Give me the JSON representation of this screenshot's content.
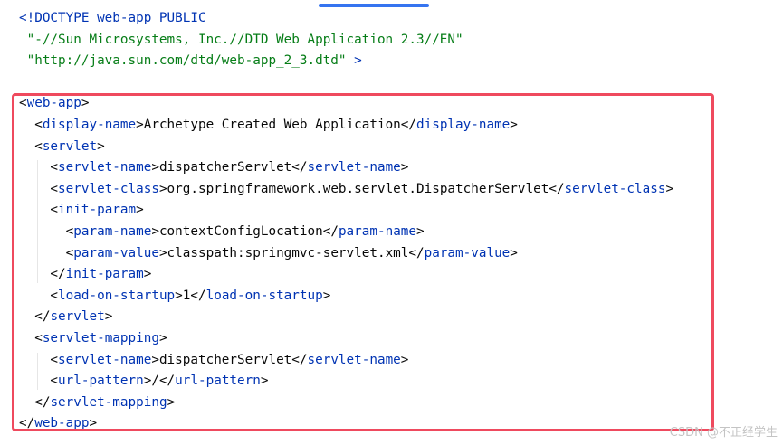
{
  "editor": {
    "colors": {
      "tag": "#0033b3",
      "text": "#080808",
      "string": "#067d17",
      "highlight": "#ef4a5e",
      "scroll_thumb": "#3574f0"
    },
    "lines": [
      [
        [
          "<!DOCTYPE web-app PUBLIC",
          "tag"
        ]
      ],
      [
        [
          " \"-//Sun Microsystems, Inc.//DTD Web Application 2.3//EN\"",
          "string"
        ]
      ],
      [
        [
          " \"http://java.sun.com/dtd/web-app_2_3.dtd\"",
          "string"
        ],
        [
          " >",
          "tag"
        ]
      ],
      [],
      [
        [
          "<",
          "text"
        ],
        [
          "web-app",
          "tag"
        ],
        [
          ">",
          "text"
        ]
      ],
      [
        [
          "  <",
          "text"
        ],
        [
          "display-name",
          "tag"
        ],
        [
          ">Archetype Created Web Application</",
          "text"
        ],
        [
          "display-name",
          "tag"
        ],
        [
          ">",
          "text"
        ]
      ],
      [
        [
          "  <",
          "text"
        ],
        [
          "servlet",
          "tag"
        ],
        [
          ">",
          "text"
        ]
      ],
      [
        [
          "    <",
          "text"
        ],
        [
          "servlet-name",
          "tag"
        ],
        [
          ">dispatcherServlet</",
          "text"
        ],
        [
          "servlet-name",
          "tag"
        ],
        [
          ">",
          "text"
        ]
      ],
      [
        [
          "    <",
          "text"
        ],
        [
          "servlet-class",
          "tag"
        ],
        [
          ">org.springframework.web.servlet.DispatcherServlet</",
          "text"
        ],
        [
          "servlet-class",
          "tag"
        ],
        [
          ">",
          "text"
        ]
      ],
      [
        [
          "    <",
          "text"
        ],
        [
          "init-param",
          "tag"
        ],
        [
          ">",
          "text"
        ]
      ],
      [
        [
          "      <",
          "text"
        ],
        [
          "param-name",
          "tag"
        ],
        [
          ">contextConfigLocation</",
          "text"
        ],
        [
          "param-name",
          "tag"
        ],
        [
          ">",
          "text"
        ]
      ],
      [
        [
          "      <",
          "text"
        ],
        [
          "param-value",
          "tag"
        ],
        [
          ">classpath:springmvc-servlet.xml</",
          "text"
        ],
        [
          "param-value",
          "tag"
        ],
        [
          ">",
          "text"
        ]
      ],
      [
        [
          "    </",
          "text"
        ],
        [
          "init-param",
          "tag"
        ],
        [
          ">",
          "text"
        ]
      ],
      [
        [
          "    <",
          "text"
        ],
        [
          "load-on-startup",
          "tag"
        ],
        [
          ">1</",
          "text"
        ],
        [
          "load-on-startup",
          "tag"
        ],
        [
          ">",
          "text"
        ]
      ],
      [
        [
          "  </",
          "text"
        ],
        [
          "servlet",
          "tag"
        ],
        [
          ">",
          "text"
        ]
      ],
      [
        [
          "  <",
          "text"
        ],
        [
          "servlet-mapping",
          "tag"
        ],
        [
          ">",
          "text"
        ]
      ],
      [
        [
          "    <",
          "text"
        ],
        [
          "servlet-name",
          "tag"
        ],
        [
          ">dispatcherServlet</",
          "text"
        ],
        [
          "servlet-name",
          "tag"
        ],
        [
          ">",
          "text"
        ]
      ],
      [
        [
          "    <",
          "text"
        ],
        [
          "url-pattern",
          "tag"
        ],
        [
          ">/</",
          "text"
        ],
        [
          "url-pattern",
          "tag"
        ],
        [
          ">",
          "text"
        ]
      ],
      [
        [
          "  </",
          "text"
        ],
        [
          "servlet-mapping",
          "tag"
        ],
        [
          ">",
          "text"
        ]
      ],
      [
        [
          "</",
          "text"
        ],
        [
          "web-app",
          "tag"
        ],
        [
          ">",
          "text"
        ]
      ]
    ]
  },
  "watermark": "CSDN @不正经学生"
}
